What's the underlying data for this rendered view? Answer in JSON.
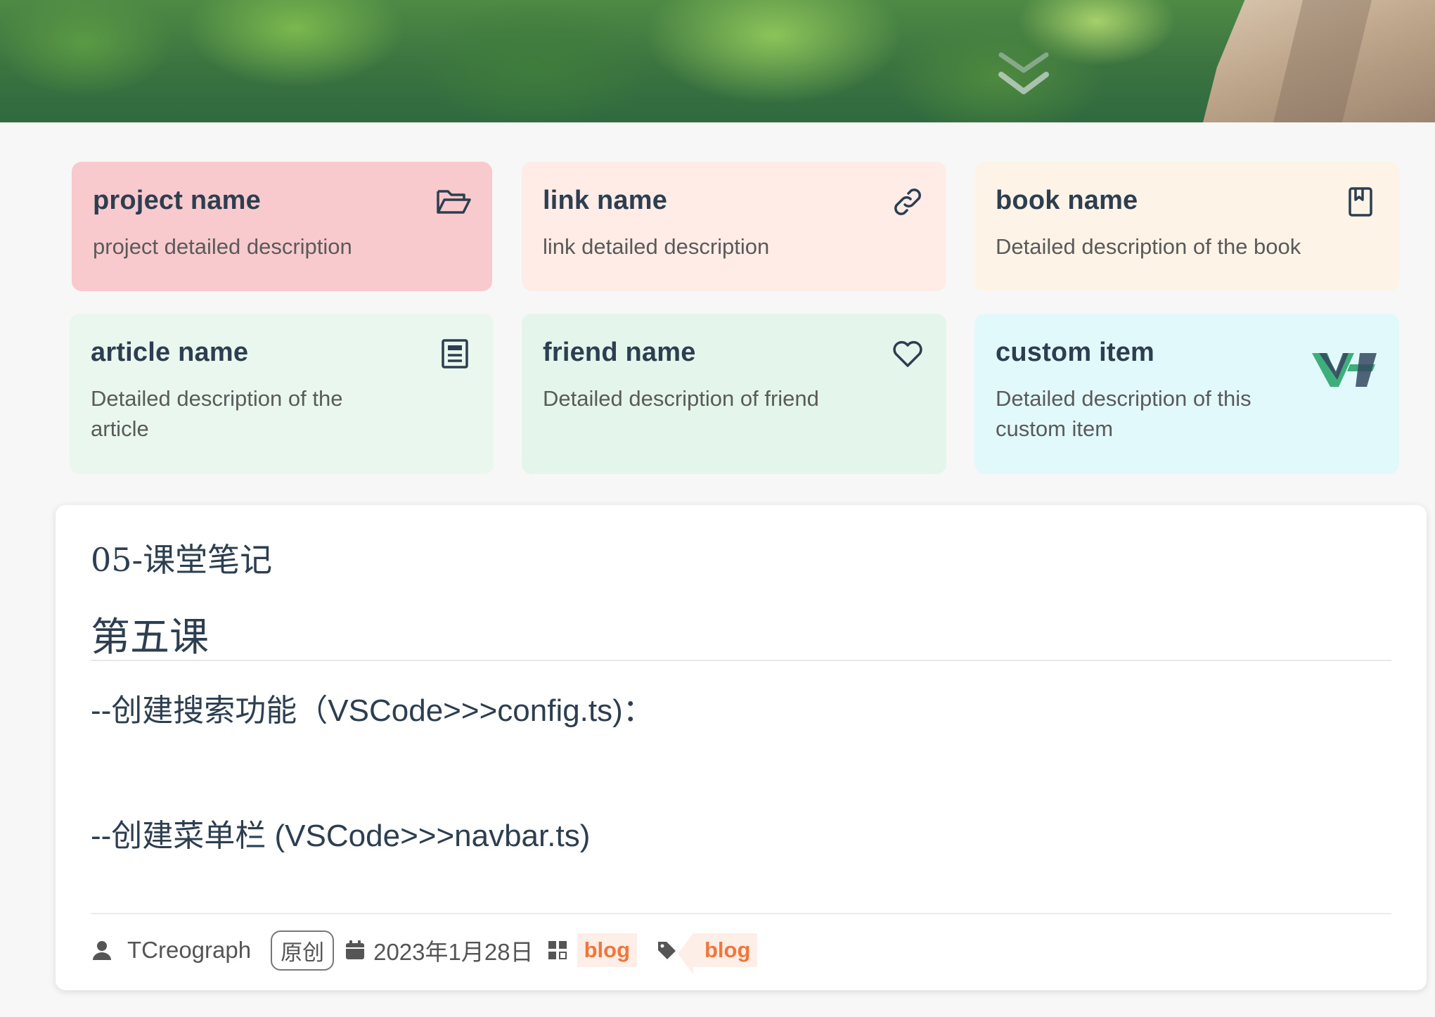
{
  "cards": [
    {
      "title": "project name",
      "description": "project detailed description",
      "icon": "folder-open-icon",
      "background": "#f8cacd"
    },
    {
      "title": "link name",
      "description": "link detailed description",
      "icon": "link-icon",
      "background": "#ffece6"
    },
    {
      "title": "book name",
      "description": "Detailed description of the book",
      "icon": "bookmark-book-icon",
      "background": "#fdf3e6"
    },
    {
      "title": "article name",
      "description": "Detailed description of the article",
      "icon": "article-icon",
      "background": "#e9f7ee"
    },
    {
      "title": "friend name",
      "description": "Detailed description of friend",
      "icon": "heart-icon",
      "background": "#e4f6eb"
    },
    {
      "title": "custom item",
      "description": "Detailed description of this custom item",
      "icon": "vuepress-hope-logo-icon",
      "background": "#e2f9fb"
    }
  ],
  "article": {
    "title": "05-课堂笔记",
    "heading": "第五课",
    "lines": [
      "--创建搜索功能（VSCode>>>config.ts)：",
      "--创建菜单栏 (VSCode>>>navbar.ts)"
    ],
    "meta": {
      "author": "TCreograph",
      "badge": "原创",
      "date": "2023年1月28日",
      "category": "blog",
      "tag": "blog"
    }
  },
  "colors": {
    "accent_tag": "#f0763a",
    "tag_background": "#fdeee8",
    "text": "#2c3e50"
  }
}
